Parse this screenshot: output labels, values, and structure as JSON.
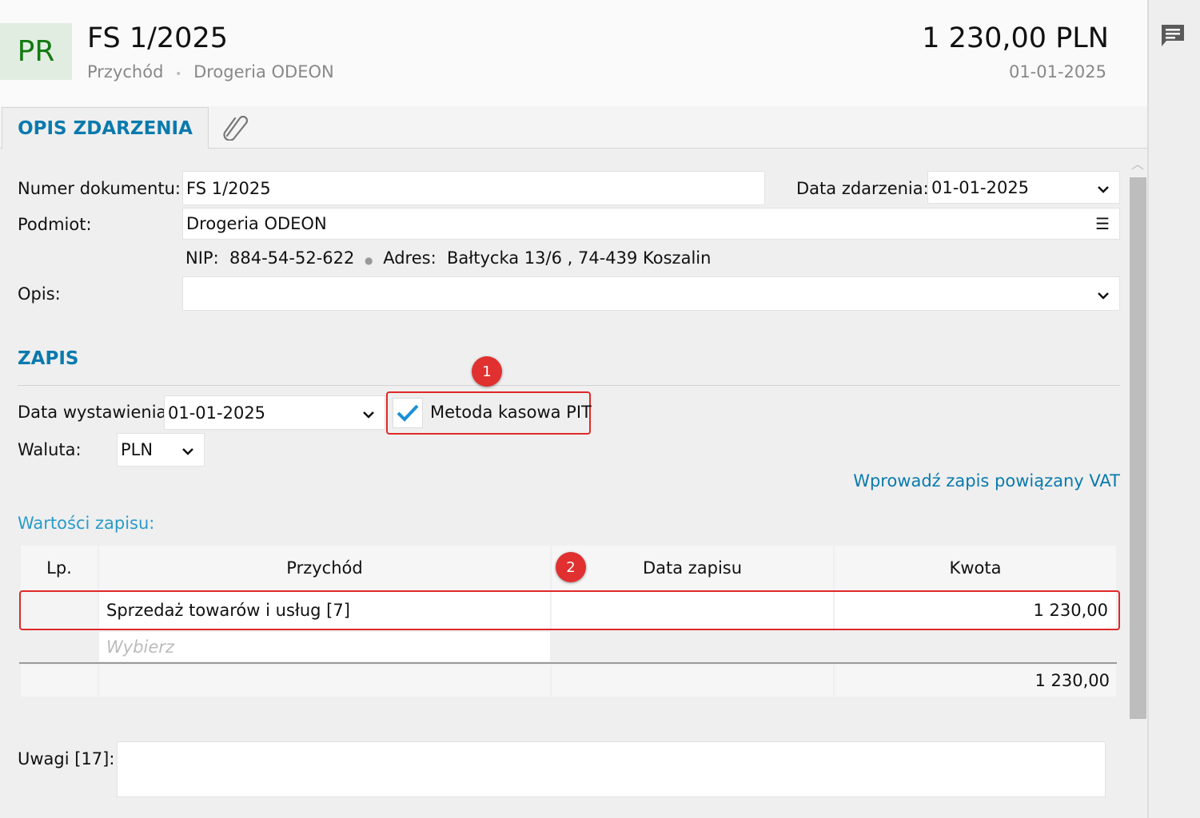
{
  "header": {
    "badge": "PR",
    "title": "FS 1/2025",
    "type": "Przychód",
    "separator": "•",
    "party": "Drogeria ODEON",
    "amount": "1 230,00 PLN",
    "date": "01-01-2025"
  },
  "tabs": [
    {
      "label": "OPIS ZDARZENIA"
    }
  ],
  "form": {
    "doc_number_label": "Numer dokumentu:",
    "doc_number": "FS 1/2025",
    "event_date_label": "Data zdarzenia:",
    "event_date": "01-01-2025",
    "party_label": "Podmiot:",
    "party": "Drogeria ODEON",
    "nip_label": "NIP:",
    "nip": "884-54-52-622",
    "address_label": "Adres:",
    "address": "Bałtycka  13/6 , 74-439 Koszalin",
    "desc_label": "Opis:",
    "desc": ""
  },
  "zapis": {
    "heading": "ZAPIS",
    "issue_date_label": "Data wystawienia",
    "issue_date": "01-01-2025",
    "cash_method_label": "Metoda kasowa PIT",
    "cash_method_checked": true,
    "currency_label": "Waluta:",
    "currency": "PLN",
    "vat_link": "Wprowadź zapis powiązany VAT",
    "values_label": "Wartości zapisu:"
  },
  "annotations": [
    "1",
    "2"
  ],
  "table": {
    "headers": [
      "Lp.",
      "Przychód",
      "Data zapisu",
      "Kwota"
    ],
    "rows": [
      {
        "lp": "",
        "income": "Sprzedaż towarów i usług  [7]",
        "date": "",
        "amount": "1 230,00"
      }
    ],
    "new_row_placeholder": "Wybierz",
    "total": "1 230,00"
  },
  "notes": {
    "label": "Uwagi [17]:",
    "value": ""
  },
  "colors": {
    "accent": "#0a7aad",
    "badge_text": "#137a13",
    "annotation": "#e03030"
  }
}
